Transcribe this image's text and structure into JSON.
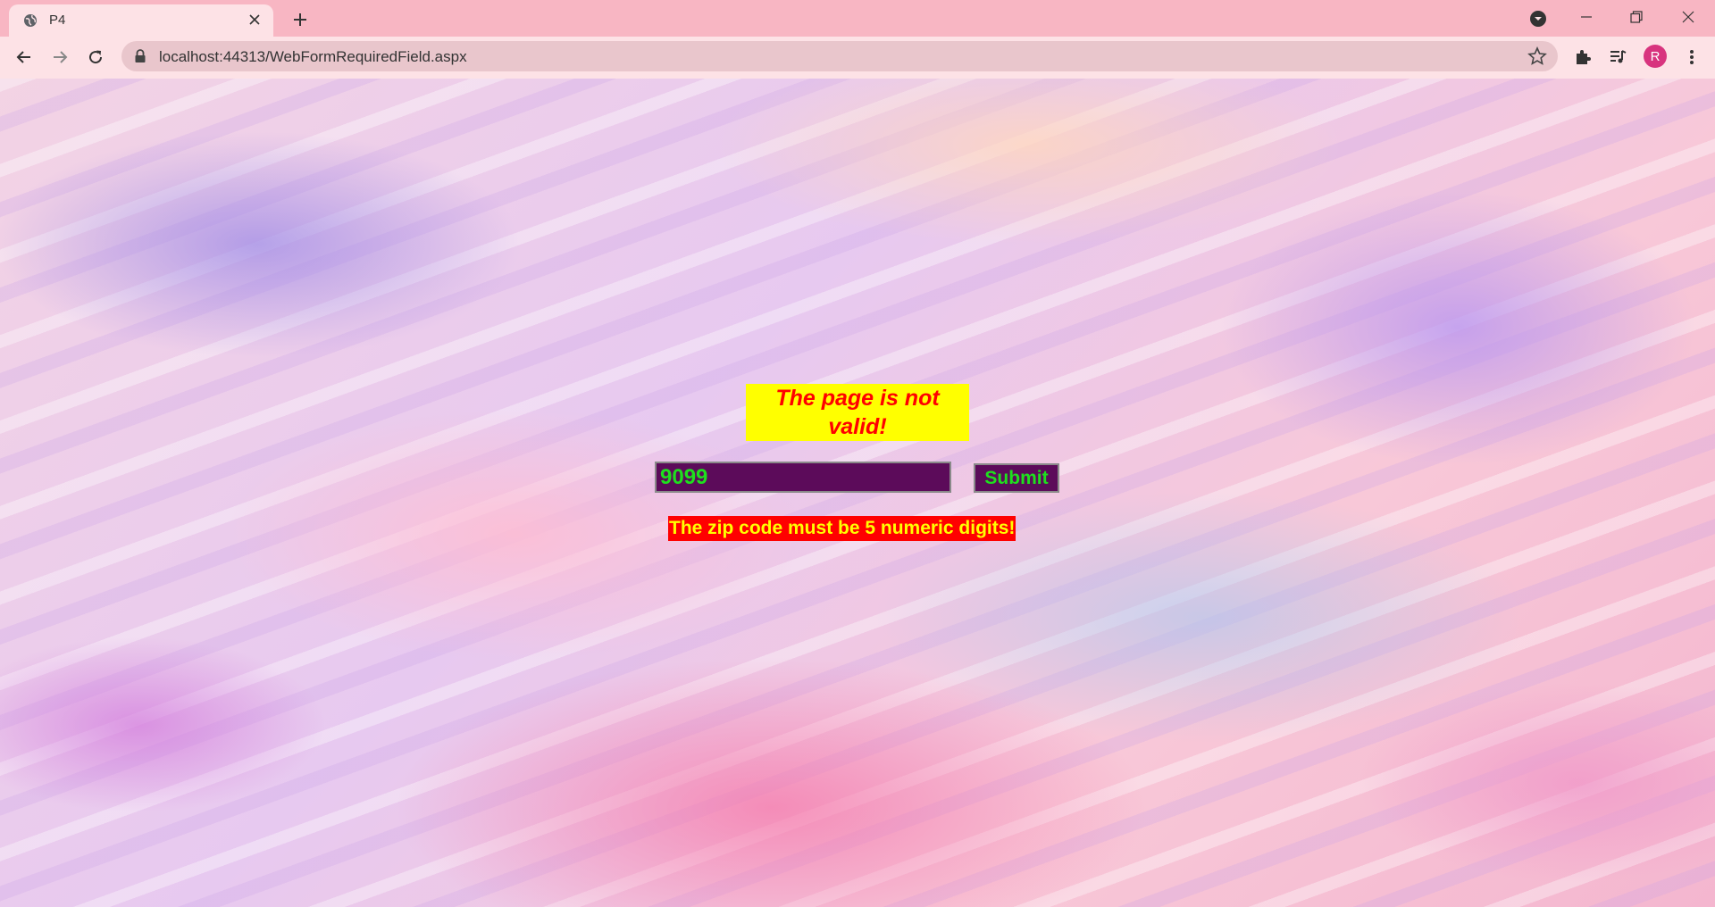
{
  "browser": {
    "tab": {
      "title": "P4",
      "favicon": "globe-icon"
    },
    "address_bar": {
      "url": "localhost:44313/WebFormRequiredField.aspx"
    },
    "profile_initial": "R",
    "colors": {
      "tabstrip": "#f8b6c3",
      "toolbar": "#fde2e6",
      "avatar": "#d8337e"
    }
  },
  "page": {
    "validation_summary": "The page is not valid!",
    "zip_input_value": "9099",
    "submit_label": "Submit",
    "error_message": "The zip code must be 5 numeric digits!",
    "colors": {
      "summary_bg": "#ffff00",
      "summary_text": "#ff0000",
      "input_bg": "#5c0b5a",
      "input_text": "#1ee01e",
      "error_bg": "#ff0000",
      "error_text": "#ffff00"
    }
  }
}
